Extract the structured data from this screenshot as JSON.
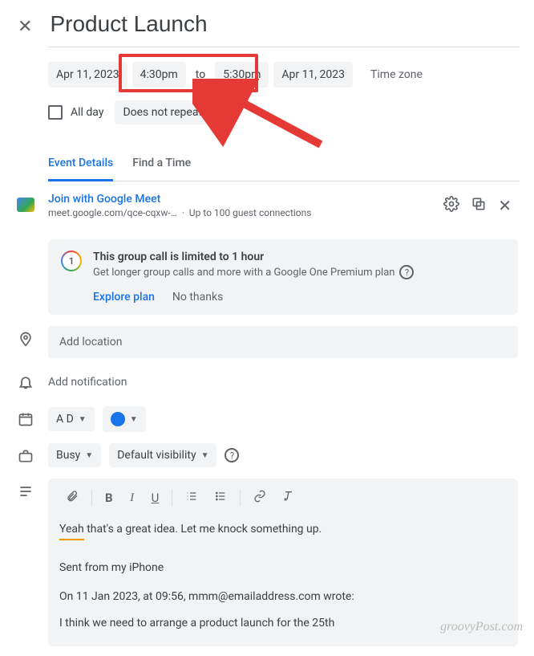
{
  "title": "Product Launch",
  "dates": {
    "start_date": "Apr 11, 2023",
    "start_time": "4:30pm",
    "to_label": "to",
    "end_time": "5:30pm",
    "end_date": "Apr 11, 2023",
    "timezone_label": "Time zone"
  },
  "allday": {
    "label": "All day"
  },
  "repeat": {
    "label": "Does not repeat"
  },
  "tabs": {
    "details": "Event Details",
    "findtime": "Find a Time"
  },
  "meet": {
    "join_label": "Join with Google Meet",
    "url_display": "meet.google.com/qce-cqxw-…",
    "guests": "Up to 100 guest connections"
  },
  "banner": {
    "badge": "1",
    "title": "This group call is limited to 1 hour",
    "subtitle": "Get longer group calls and more with a Google One Premium plan",
    "explore": "Explore plan",
    "dismiss": "No thanks"
  },
  "location": {
    "placeholder": "Add location"
  },
  "notification": {
    "label": "Add notification"
  },
  "calendar": {
    "owner_initials": "A D"
  },
  "availability": {
    "busy": "Busy",
    "visibility": "Default visibility"
  },
  "description": {
    "spellword": "Yeah",
    "line1_rest": " that's a great idea. Let me knock something up.",
    "sent_from": "Sent from my iPhone",
    "quote_header": "On 11 Jan 2023, at 09:56, mmm@emailaddress.com wrote:",
    "quote_body": "I think we need to arrange a product launch for the 25th"
  },
  "watermark": "groovyPost.com"
}
